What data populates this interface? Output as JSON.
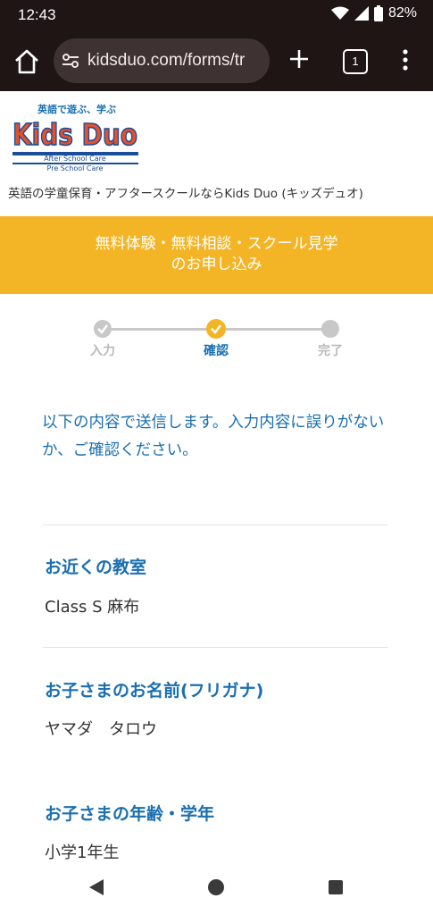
{
  "status_bar": {
    "time": "12:43",
    "battery": "82%"
  },
  "browser": {
    "url": "kidsduo.com/forms/tr",
    "tab_count": "1"
  },
  "logo": {
    "top_text": "英語で遊ぶ、学ぶ",
    "brand": "Kids Duo",
    "line1": "After School Care",
    "line2": "Pre School Care"
  },
  "tagline": "英語の学童保育・アフタースクールならKids Duo (キッズデュオ)",
  "banner": {
    "line1": "無料体験・無料相談・スクール見学",
    "line2": "のお申し込み"
  },
  "steps": [
    {
      "label": "入力",
      "state": "done"
    },
    {
      "label": "確認",
      "state": "current"
    },
    {
      "label": "完了",
      "state": "pending"
    }
  ],
  "intro": "以下の内容で送信します。入力内容に誤りがないか、ご確認ください。",
  "fields": [
    {
      "label": "お近くの教室",
      "value": "Class S 麻布"
    },
    {
      "label": "お子さまのお名前(フリガナ)",
      "value": "ヤマダ　タロウ"
    },
    {
      "label": "お子さまの年齢・学年",
      "value": "小学1年生"
    }
  ],
  "colors": {
    "accent_blue": "#1a6fb0",
    "banner_yellow": "#f3b525",
    "step_gray": "#c8c8c8",
    "browser_bg": "#1f1515"
  }
}
